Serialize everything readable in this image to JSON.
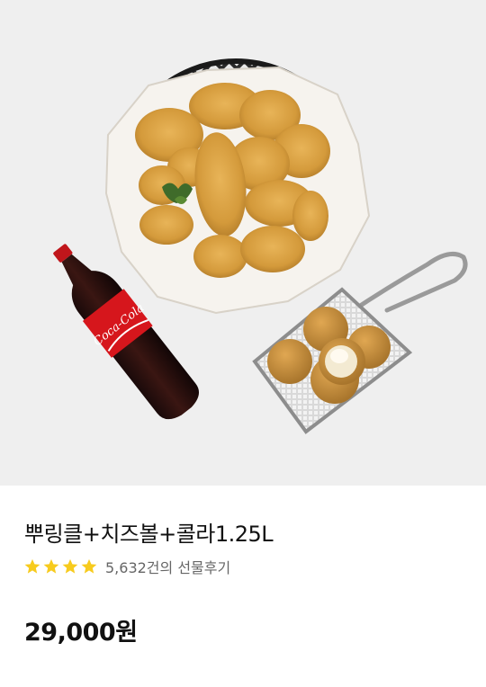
{
  "product": {
    "name": "뿌링클+치즈볼+콜라1.25L",
    "rating_stars": 4,
    "review_text": "5,632건의 선물후기",
    "price": "29,000원",
    "cola_label": "Coca-Cola"
  },
  "colors": {
    "image_background": "#efefef",
    "star": "#f7cb1e",
    "price": "#111111",
    "review_text": "#666666"
  },
  "icons": [
    "star-icon"
  ]
}
